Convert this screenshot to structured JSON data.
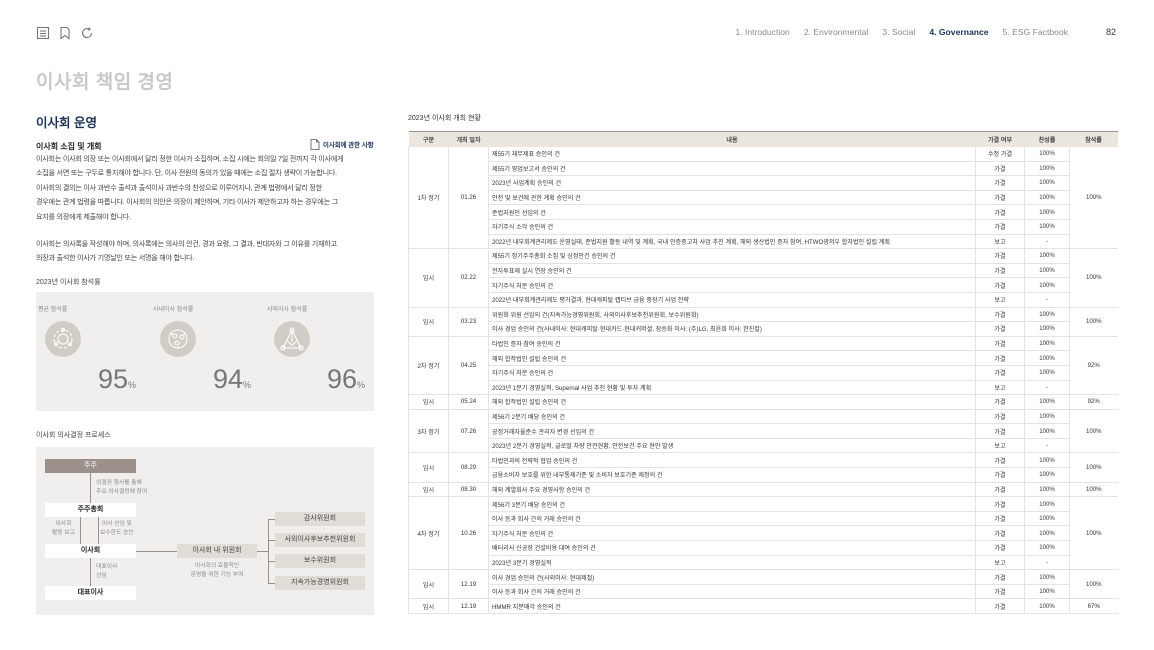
{
  "toolbar": {
    "icons": [
      "list-icon",
      "bookmark-icon",
      "refresh-icon"
    ]
  },
  "nav": {
    "items": [
      "1. Introduction",
      "2. Environmental",
      "3. Social",
      "4. Governance",
      "5. ESG Factbook"
    ],
    "active": "4. Governance",
    "page": "82"
  },
  "page_title": "이사회 책임 경영",
  "section_title": "이사회 운영",
  "subsection_title": "이사회 소집 및 개회",
  "link_label": "이사회에 관한 사항",
  "paragraph1": [
    "이사회는 이사회 의장 또는 이사회에서 달리 정한 이사가 소집하며, 소집 시에는 회의일 7일 전까지 각 이사에게",
    "소집을 서면 또는 구두로 통지해야 합니다. 단, 이사 전원의 동의가 있을 때에는 소집 절차 생략이 가능합니다.",
    "이사회의 결의는 이사 과반수 출석과 출석이사 과반수의 찬성으로 이루어지나, 관계 법령에서 달리 정한",
    "경우에는 관계 법령을 따릅니다. 이사회의 의안은 의장이 제안하며, 기타 이사가 제안하고자 하는 경우에는 그",
    "요지를 의장에게 제출해야 합니다."
  ],
  "paragraph2": [
    "이사회는 의사록을 작성해야 하며, 의사록에는 의사의 안건, 경과 요령, 그 결과, 반대자와 그 이유를 기재하고",
    "의장과 출석한 이사가 기명날인 또는 서명을 해야 합니다."
  ],
  "attendance": {
    "caption": "2023년 이사회 참석률",
    "items": [
      {
        "label": "평균 참석률",
        "value": "95",
        "unit": "%"
      },
      {
        "label": "사내이사 참석률",
        "value": "94",
        "unit": "%"
      },
      {
        "label": "사외이사 참석률",
        "value": "96",
        "unit": "%"
      }
    ]
  },
  "process": {
    "caption": "이사회 의사결정 프로세스",
    "shareholders": "주주",
    "shareholders_note": [
      "의결권 행사를 통해",
      "주요 의사결정에 참여"
    ],
    "general_meeting": "주주총회",
    "report_note": [
      "이사회",
      "활동 보고"
    ],
    "elect_note": [
      "이사 선임 및",
      "보수한도 승인"
    ],
    "board": "이사회",
    "committee_box": "이사회 내 위원회",
    "committee_note": [
      "이사회의 효율적인",
      "운영을 위한 기능 부여"
    ],
    "ceo_note": [
      "대표이사",
      "선임"
    ],
    "ceo": "대표이사",
    "committees": [
      "감사위원회",
      "사외이사후보추천위원회",
      "보수위원회",
      "지속가능경영위원회"
    ]
  },
  "table": {
    "caption": "2023년 이사회 개최 현황",
    "headers": [
      "구분",
      "개최 일자",
      "내용",
      "가결 여부",
      "찬성률",
      "참석률"
    ],
    "groups": [
      {
        "type": "1차 정기",
        "date": "01.26",
        "attendance": "100%",
        "rows": [
          [
            "제55기 재무제표 승인의 건",
            "수정 가결",
            "100%"
          ],
          [
            "제55기 영업보고서 승인의 건",
            "가결",
            "100%"
          ],
          [
            "2023년 사업계획 승인의 건",
            "가결",
            "100%"
          ],
          [
            "안전 및 보건에 관한 계획 승인의 건",
            "가결",
            "100%"
          ],
          [
            "준법지원인 선임의 건",
            "가결",
            "100%"
          ],
          [
            "자기주식 소각 승인의 건",
            "가결",
            "100%"
          ],
          [
            "2022년 내부회계관리제도 운영실태, 준법지원 활동 내역 및 계획, 국내 인증중고차 사업 추진 계획, 해외 생산법인 증자 참여, HTWO광저우 합자법인 설립 계획",
            "보고",
            "-"
          ]
        ]
      },
      {
        "type": "임시",
        "date": "02.22",
        "attendance": "100%",
        "rows": [
          [
            "제55기 정기주주총회 소집 및 상정안건 승인의 건",
            "가결",
            "100%"
          ],
          [
            "전자투표제 실시 연장 승인의 건",
            "가결",
            "100%"
          ],
          [
            "자기주식 처분 승인의 건",
            "가결",
            "100%"
          ],
          [
            "2022년 내부회계관리제도 평가결과, 현대캐피탈 캡티브 금융 중장기 사업 전략",
            "보고",
            "-"
          ]
        ]
      },
      {
        "type": "임시",
        "date": "03.23",
        "attendance": "100%",
        "rows": [
          [
            "위원회 위원 선임의 건(지속가능경영위원회, 사외이사후보추천위원회, 보수위원회)",
            "가결",
            "100%"
          ],
          [
            "이사 경업 승인의 건(사내이사: 현대캐피탈·현대카드·현대커머셜, 장승화 이사: (주)LG, 최윤희 이사: 한진칼)",
            "가결",
            "100%"
          ]
        ]
      },
      {
        "type": "2차 정기",
        "date": "04.25",
        "attendance": "92%",
        "rows": [
          [
            "타법인 증자 참여 승인의 건",
            "가결",
            "100%"
          ],
          [
            "해외 합작법인 설립 승인의 건",
            "가결",
            "100%"
          ],
          [
            "자기주식 처분 승인의 건",
            "가결",
            "100%"
          ],
          [
            "2023년 1분기 경영실적, Supernal 사업 추진 현황 및 투자 계획",
            "보고",
            "-"
          ]
        ]
      },
      {
        "type": "임시",
        "date": "05.24",
        "attendance": "92%",
        "rows": [
          [
            "해외 합작법인 설립 승인의 건",
            "가결",
            "100%"
          ]
        ]
      },
      {
        "type": "3차 정기",
        "date": "07.26",
        "attendance": "100%",
        "rows": [
          [
            "제56기 2분기 배당 승인의 건",
            "가결",
            "100%"
          ],
          [
            "공정거래자율준수 관리자 변경 선임의 건",
            "가결",
            "100%"
          ],
          [
            "2023년 2분기 경영실적, 글로벌 차량 안전현황, 안전보건 주요 현안 발생",
            "보고",
            "-"
          ]
        ]
      },
      {
        "type": "임시",
        "date": "08.29",
        "attendance": "100%",
        "rows": [
          [
            "타법인과의 전략적 협업 승인의 건",
            "가결",
            "100%"
          ],
          [
            "금융소비자 보호를 위한 내부통제기준 및 소비자 보호기준 제정의 건",
            "가결",
            "100%"
          ]
        ]
      },
      {
        "type": "임시",
        "date": "08.30",
        "attendance": "100%",
        "rows": [
          [
            "해외 계열회사 주요 경영사항 승인의 건",
            "가결",
            "100%"
          ]
        ]
      },
      {
        "type": "4차 정기",
        "date": "10.26",
        "attendance": "100%",
        "rows": [
          [
            "제56기 3분기 배당 승인의 건",
            "가결",
            "100%"
          ],
          [
            "이사 등과 회사 간의 거래 승인의 건",
            "가결",
            "100%"
          ],
          [
            "자기주식 처분 승인의 건",
            "가결",
            "100%"
          ],
          [
            "배터리사 신공장 건설비용 대여 승인의 건",
            "가결",
            "100%"
          ],
          [
            "2023년 3분기 경영실적",
            "보고",
            "-"
          ]
        ]
      },
      {
        "type": "임시",
        "date": "12.19",
        "attendance": "100%",
        "rows": [
          [
            "이사 경업 승인의 건(사외이사: 현대제철)",
            "가결",
            "100%"
          ],
          [
            "이사 등과 회사 간의 거래 승인의 건",
            "가결",
            "100%"
          ]
        ]
      },
      {
        "type": "임시",
        "date": "12.19",
        "attendance": "67%",
        "rows": [
          [
            "HMMR 지분매각 승인의 건",
            "가결",
            "100%"
          ]
        ]
      }
    ]
  }
}
